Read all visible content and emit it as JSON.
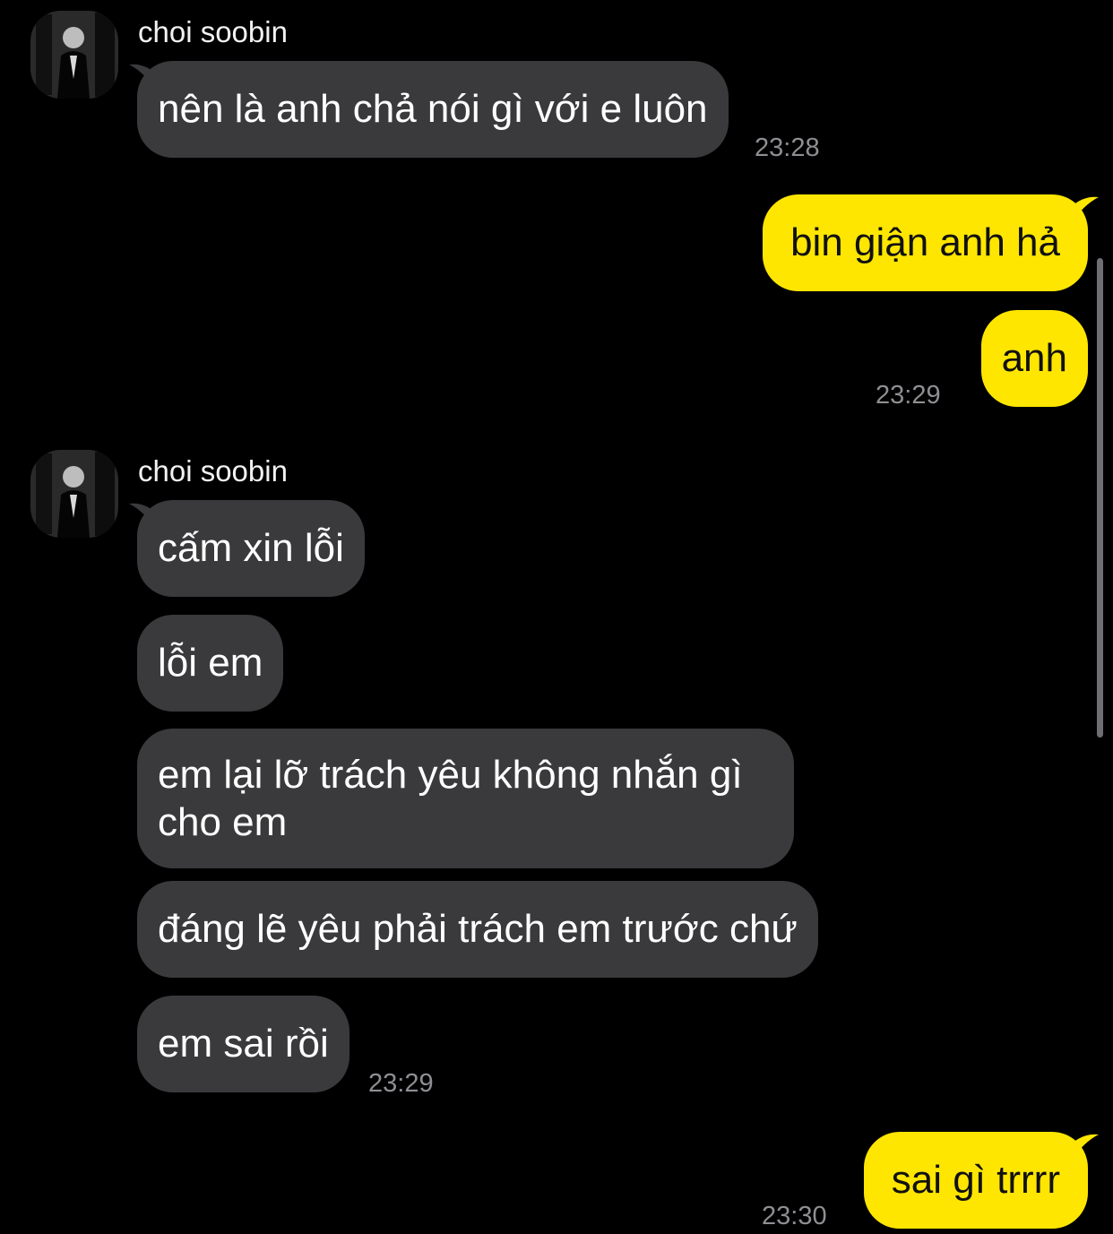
{
  "chat": {
    "sender_name_1": "choi soobin",
    "sender_name_2": "choi soobin",
    "messages": [
      {
        "text": "nên là anh chả nói gì với e luôn"
      },
      {
        "text": "bin giận anh hả"
      },
      {
        "text": "anh"
      },
      {
        "text": "cấm xin lỗi"
      },
      {
        "text": "lỗi em"
      },
      {
        "text": "em lại lỡ trách yêu không nhắn gì cho em"
      },
      {
        "text": "đáng lẽ yêu phải trách em trước chứ"
      },
      {
        "text": "em sai rồi"
      },
      {
        "text": "sai gì trrrr"
      }
    ],
    "times": [
      "23:28",
      "23:29",
      "23:29",
      "23:30"
    ]
  },
  "colors": {
    "background": "#000000",
    "incoming_bubble": "#3a3a3c",
    "outgoing_bubble": "#ffe600",
    "timestamp": "#8e8e93"
  }
}
